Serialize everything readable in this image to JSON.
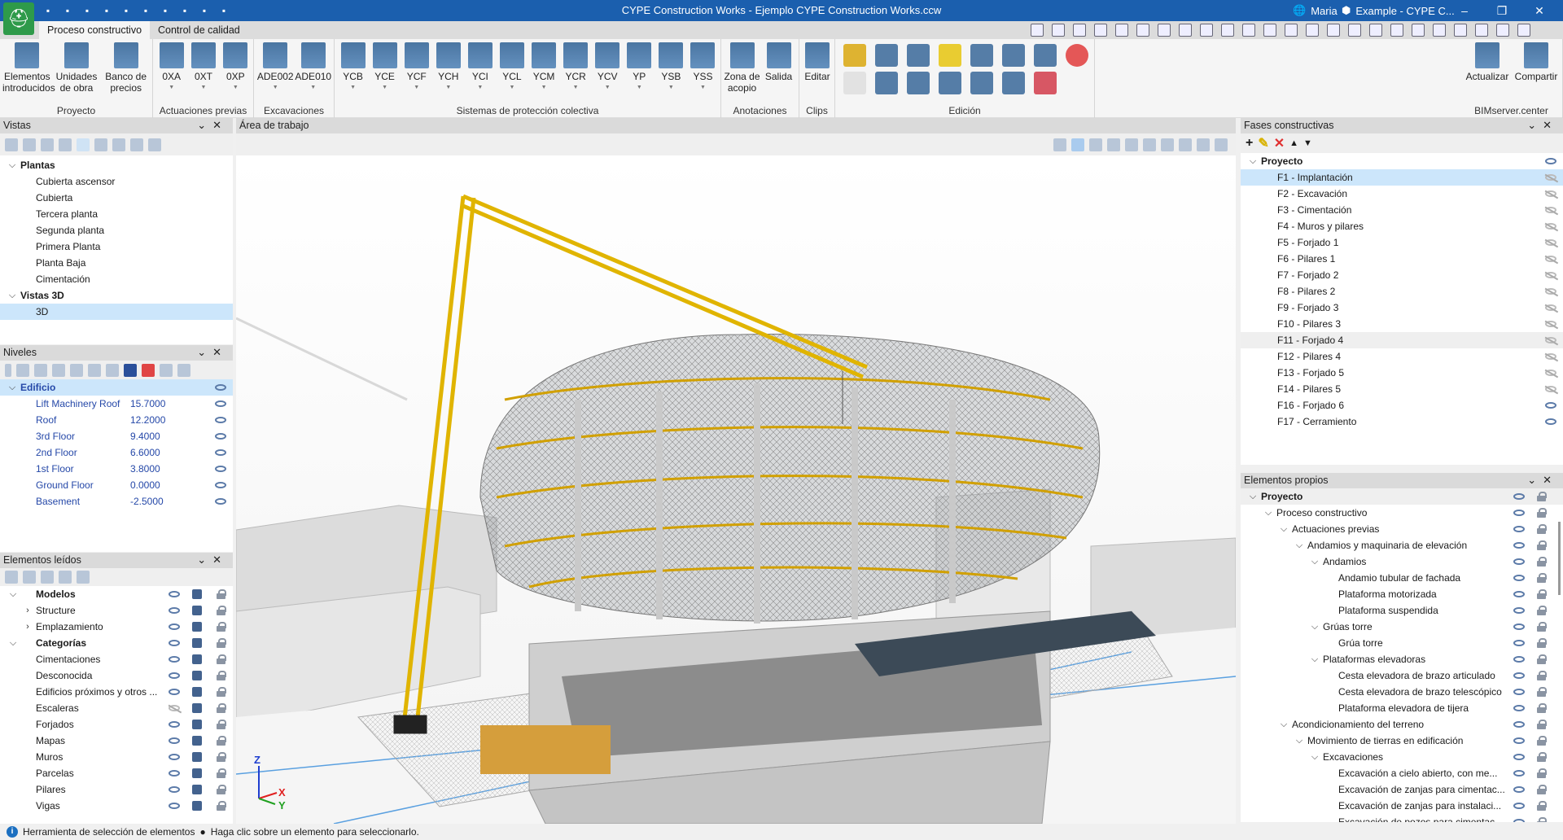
{
  "titlebar": {
    "title": "CYPE Construction Works - Ejemplo CYPE Construction Works.ccw",
    "user": "Maria",
    "project": "Example - CYPE C...",
    "minimize": "–",
    "restore": "❐",
    "close": "✕",
    "quick_access": [
      "save-icon",
      "undo-icon",
      "redo-icon",
      "search-icon",
      "print-icon",
      "print-preview-icon",
      "export-icon",
      "bimserver-icon",
      "bimserver-share-icon",
      "customize-icon"
    ]
  },
  "tabs": [
    {
      "label": "Proceso constructivo",
      "active": true
    },
    {
      "label": "Control de calidad",
      "active": false
    }
  ],
  "ribbon": {
    "groups": [
      {
        "label": "Proyecto",
        "buttons": [
          "Elementos introducidos",
          "Unidades de obra",
          "Banco de precios"
        ]
      },
      {
        "label": "Actuaciones previas",
        "buttons": [
          "0XA",
          "0XT",
          "0XP"
        ]
      },
      {
        "label": "Excavaciones",
        "buttons": [
          "ADE002",
          "ADE010"
        ]
      },
      {
        "label": "Sistemas de protección colectiva",
        "buttons": [
          "YCB",
          "YCE",
          "YCF",
          "YCH",
          "YCI",
          "YCL",
          "YCM",
          "YCR",
          "YCV",
          "YP",
          "YSB",
          "YSS"
        ]
      },
      {
        "label": "Anotaciones",
        "buttons": [
          "Zona de acopio",
          "Salida"
        ]
      },
      {
        "label": "Clips",
        "buttons": [
          "Editar"
        ]
      },
      {
        "label": "Edición",
        "buttons": []
      },
      {
        "label": "BIMserver.center",
        "buttons": [
          "Actualizar",
          "Compartir"
        ]
      }
    ]
  },
  "vistas": {
    "title": "Vistas",
    "tree": [
      {
        "label": "Plantas",
        "level": 0,
        "expanded": true,
        "bold": true
      },
      {
        "label": "Cubierta ascensor",
        "level": 1
      },
      {
        "label": "Cubierta",
        "level": 1
      },
      {
        "label": "Tercera planta",
        "level": 1
      },
      {
        "label": "Segunda planta",
        "level": 1
      },
      {
        "label": "Primera Planta",
        "level": 1
      },
      {
        "label": "Planta Baja",
        "level": 1
      },
      {
        "label": "Cimentación",
        "level": 1
      },
      {
        "label": "Vistas 3D",
        "level": 0,
        "expanded": true,
        "bold": true
      },
      {
        "label": "3D",
        "level": 1,
        "selected": true
      }
    ]
  },
  "niveles": {
    "title": "Niveles",
    "root": "Edificio",
    "levels": [
      {
        "name": "Lift Machinery Roof",
        "elev": "15.7000"
      },
      {
        "name": "Roof",
        "elev": "12.2000"
      },
      {
        "name": "3rd Floor",
        "elev": "9.4000"
      },
      {
        "name": "2nd Floor",
        "elev": "6.6000"
      },
      {
        "name": "1st Floor",
        "elev": "3.8000"
      },
      {
        "name": "Ground Floor",
        "elev": "0.0000"
      },
      {
        "name": "Basement",
        "elev": "-2.5000"
      }
    ]
  },
  "elementos_leidos": {
    "title": "Elementos leídos",
    "tree": [
      {
        "label": "Modelos",
        "level": 0,
        "expanded": true,
        "bold": true,
        "visible": true
      },
      {
        "label": "Structure",
        "level": 1,
        "collapsed": true,
        "visible": true
      },
      {
        "label": "Emplazamiento",
        "level": 1,
        "collapsed": true,
        "visible": true
      },
      {
        "label": "Categorías",
        "level": 0,
        "expanded": true,
        "bold": true,
        "visible": true
      },
      {
        "label": "Cimentaciones",
        "level": 1,
        "visible": true
      },
      {
        "label": "Desconocida",
        "level": 1,
        "visible": true
      },
      {
        "label": "Edificios próximos y otros ...",
        "level": 1,
        "visible": true
      },
      {
        "label": "Escaleras",
        "level": 1,
        "visible": false
      },
      {
        "label": "Forjados",
        "level": 1,
        "visible": true
      },
      {
        "label": "Mapas",
        "level": 1,
        "visible": true
      },
      {
        "label": "Muros",
        "level": 1,
        "visible": true
      },
      {
        "label": "Parcelas",
        "level": 1,
        "visible": true
      },
      {
        "label": "Pilares",
        "level": 1,
        "visible": true
      },
      {
        "label": "Vigas",
        "level": 1,
        "visible": true
      }
    ]
  },
  "workspace": {
    "title": "Área de trabajo",
    "axes": {
      "z": "Z",
      "x": "X",
      "y": "Y"
    }
  },
  "fases": {
    "title": "Fases constructivas",
    "root": "Proyecto",
    "items": [
      {
        "label": "F1 - Implantación",
        "visible": false,
        "selected": true
      },
      {
        "label": "F2 - Excavación",
        "visible": false
      },
      {
        "label": "F3 - Cimentación",
        "visible": false
      },
      {
        "label": "F4 - Muros y pilares",
        "visible": false
      },
      {
        "label": "F5 - Forjado 1",
        "visible": false
      },
      {
        "label": "F6 - Pilares 1",
        "visible": false
      },
      {
        "label": "F7 - Forjado 2",
        "visible": false
      },
      {
        "label": "F8 - Pilares 2",
        "visible": false
      },
      {
        "label": "F9 - Forjado 3",
        "visible": false
      },
      {
        "label": "F10 - Pilares 3",
        "visible": false
      },
      {
        "label": "F11 - Forjado 4",
        "visible": false,
        "hover": true
      },
      {
        "label": "F12 - Pilares 4",
        "visible": false
      },
      {
        "label": "F13 - Forjado 5",
        "visible": false
      },
      {
        "label": "F14 - Pilares 5",
        "visible": false
      },
      {
        "label": "F16 - Forjado 6",
        "visible": true
      },
      {
        "label": "F17 - Cerramiento",
        "visible": true
      }
    ]
  },
  "elementos_propios": {
    "title": "Elementos propios",
    "tree": [
      {
        "label": "Proyecto",
        "level": 0,
        "bold": true,
        "expanded": true
      },
      {
        "label": "Proceso constructivo",
        "level": 1,
        "expanded": true
      },
      {
        "label": "Actuaciones previas",
        "level": 2,
        "expanded": true
      },
      {
        "label": "Andamios y maquinaria de elevación",
        "level": 3,
        "expanded": true
      },
      {
        "label": "Andamios",
        "level": 4,
        "expanded": true
      },
      {
        "label": "Andamio tubular de fachada",
        "level": 5
      },
      {
        "label": "Plataforma motorizada",
        "level": 5
      },
      {
        "label": "Plataforma suspendida",
        "level": 5
      },
      {
        "label": "Grúas torre",
        "level": 4,
        "expanded": true
      },
      {
        "label": "Grúa torre",
        "level": 5
      },
      {
        "label": "Plataformas elevadoras",
        "level": 4,
        "expanded": true
      },
      {
        "label": "Cesta elevadora de brazo articulado",
        "level": 5
      },
      {
        "label": "Cesta elevadora de brazo telescópico",
        "level": 5
      },
      {
        "label": "Plataforma elevadora de tijera",
        "level": 5
      },
      {
        "label": "Acondicionamiento del terreno",
        "level": 2,
        "expanded": true
      },
      {
        "label": "Movimiento de tierras en edificación",
        "level": 3,
        "expanded": true
      },
      {
        "label": "Excavaciones",
        "level": 4,
        "expanded": true
      },
      {
        "label": "Excavación a cielo abierto, con me...",
        "level": 5
      },
      {
        "label": "Excavación de zanjas para cimentac...",
        "level": 5
      },
      {
        "label": "Excavación de zanjas para instalaci...",
        "level": 5
      },
      {
        "label": "Excavación de pozos para cimentac...",
        "level": 5
      }
    ]
  },
  "statusbar": {
    "tool": "Herramienta de selección de elementos",
    "hint": "Haga clic sobre un elemento para seleccionarlo."
  },
  "colors": {
    "titlebar": "#1b5fae",
    "selection": "#cce6fb",
    "crane": "#e0b400",
    "tree_blue": "#2548a8"
  }
}
